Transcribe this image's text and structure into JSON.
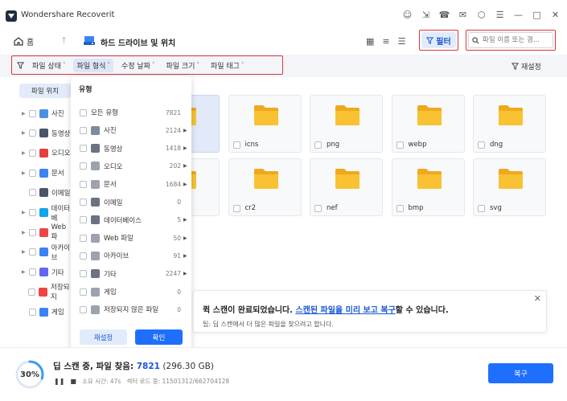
{
  "app": {
    "title": "Wondershare Recoverit"
  },
  "titlebar_icons": [
    "user-icon",
    "export-icon",
    "headset-icon",
    "mail-icon",
    "cube-icon",
    "menu-icon",
    "minimize-icon",
    "maximize-icon",
    "close-icon"
  ],
  "nav": {
    "home_label": "홈",
    "location_label": "하드 드라이브 및 위치",
    "filter_label": "필터",
    "search_placeholder": "파일 이름 또는 경..."
  },
  "filterbar": {
    "items": [
      {
        "label": "파일 상태",
        "active": false
      },
      {
        "label": "파일 형식",
        "active": true
      },
      {
        "label": "수정 날짜",
        "active": false
      },
      {
        "label": "파일 크기",
        "active": false
      },
      {
        "label": "파일 태그",
        "active": false
      }
    ],
    "reset_label": "재설정"
  },
  "sidebar": {
    "tab_label": "파일 위치",
    "items": [
      {
        "label": "사진",
        "color": "#4a90e2",
        "caret": true
      },
      {
        "label": "동영상",
        "color": "#4a5568",
        "caret": true
      },
      {
        "label": "오디오",
        "color": "#e53e3e",
        "caret": true
      },
      {
        "label": "문서",
        "color": "#3b82f6",
        "caret": true
      },
      {
        "label": "이메일",
        "color": "#4a5568",
        "caret": false
      },
      {
        "label": "데이터베",
        "color": "#0ea5e9",
        "caret": true
      },
      {
        "label": "Web 파",
        "color": "#ef4444",
        "caret": true
      },
      {
        "label": "아카이브",
        "color": "#3b82f6",
        "caret": true
      },
      {
        "label": "기타",
        "color": "#6366f1",
        "caret": true
      },
      {
        "label": "저장되지",
        "color": "#ef4444",
        "caret": false
      },
      {
        "label": "게임",
        "color": "#3b82f6",
        "caret": false
      }
    ]
  },
  "tiles": [
    {
      "label": "",
      "selected": true
    },
    {
      "label": "icns"
    },
    {
      "label": "png"
    },
    {
      "label": "webp"
    },
    {
      "label": "dng"
    },
    {
      "label": ""
    },
    {
      "label": "cr2"
    },
    {
      "label": "nef"
    },
    {
      "label": "bmp"
    },
    {
      "label": "svg"
    }
  ],
  "dropdown": {
    "title": "유형",
    "rows": [
      {
        "label": "모든 유형",
        "count": "7821",
        "arrow": false,
        "icon": "none"
      },
      {
        "label": "사진",
        "count": "2124",
        "arrow": true,
        "icon": "#7d8aa0"
      },
      {
        "label": "동영상",
        "count": "1418",
        "arrow": true,
        "icon": "#6b7280"
      },
      {
        "label": "오디오",
        "count": "202",
        "arrow": true,
        "icon": "#9ca3af"
      },
      {
        "label": "문서",
        "count": "1684",
        "arrow": true,
        "icon": "#9ca3af"
      },
      {
        "label": "이메일",
        "count": "0",
        "arrow": false,
        "icon": "#6b7280"
      },
      {
        "label": "데이터베이스",
        "count": "5",
        "arrow": true,
        "icon": "#6b7280"
      },
      {
        "label": "Web 파일",
        "count": "50",
        "arrow": true,
        "icon": "#9ca3af"
      },
      {
        "label": "아카이브",
        "count": "91",
        "arrow": true,
        "icon": "#9ca3af"
      },
      {
        "label": "기타",
        "count": "2247",
        "arrow": true,
        "icon": "#6b7280"
      },
      {
        "label": "게임",
        "count": "0",
        "arrow": false,
        "icon": "#9ca3af"
      },
      {
        "label": "저장되지 않은 파일",
        "count": "0",
        "arrow": false,
        "icon": "#9ca3af"
      }
    ],
    "reset_label": "재설정",
    "ok_label": "확인"
  },
  "notice": {
    "text_before": "퀵 스캔이 완료되었습니다. ",
    "link_text": "스캔된 파일을 미리 보고 복구",
    "text_after": "할 수 있습니다.",
    "tip": "팁: 딥 스캔에서 더 많은 파일을 찾으려고 합니다."
  },
  "status": {
    "progress_percent": 30,
    "progress_text": "30%",
    "scan_label": "딥 스캔 중, 파일 찾음: ",
    "file_count": "7821",
    "size": " (296.30 GB)",
    "elapsed_label": "소요 시간: 47s",
    "sector_label": "섹터 로드 중: 11501312/662704128"
  },
  "recover_label": "복구",
  "colors": {
    "accent": "#1f6fff",
    "highlight_border": "#d9363e",
    "folder": "#f7b924"
  }
}
